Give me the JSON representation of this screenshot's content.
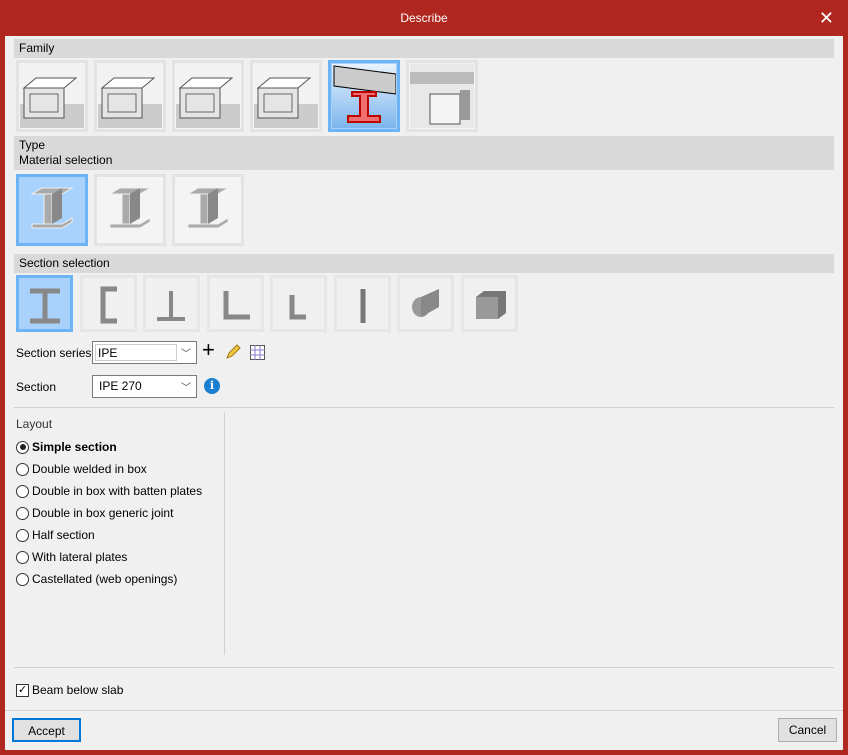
{
  "window": {
    "title": "Describe"
  },
  "family": {
    "label": "Family",
    "items": [
      "family-1",
      "family-2",
      "family-3",
      "family-4",
      "family-5",
      "family-6"
    ],
    "selected": 4
  },
  "type": {
    "label": "Type",
    "material_label": "Material selection",
    "items": [
      "rolled-steel",
      "welded-steel",
      "cold-formed-steel"
    ],
    "selected": 0
  },
  "section_selection": {
    "label": "Section selection",
    "items": [
      "i-section",
      "channel-section",
      "t-section",
      "angle-section",
      "small-angle-section",
      "plate-section",
      "round-section",
      "box-section"
    ],
    "selected": 0
  },
  "section_series": {
    "label": "Section series",
    "value": "IPE"
  },
  "section": {
    "label": "Section",
    "value": "IPE 270"
  },
  "layout": {
    "label": "Layout",
    "options": [
      "Simple section",
      "Double welded in box",
      "Double in box with batten plates",
      "Double in box generic joint",
      "Half section",
      "With lateral plates",
      "Castellated (web openings)"
    ],
    "selected": 0
  },
  "beam_below_slab": {
    "label": "Beam below slab",
    "checked": true
  },
  "buttons": {
    "accept": "Accept",
    "cancel": "Cancel"
  }
}
